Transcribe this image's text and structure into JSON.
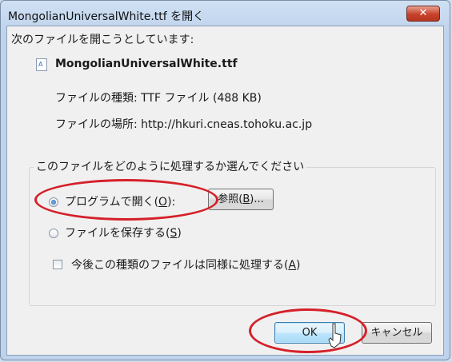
{
  "window": {
    "title": "MongolianUniversalWhite.ttf を開く",
    "close_label": "✕"
  },
  "prompt": "次のファイルを開こうとしています:",
  "file": {
    "name": "MongolianUniversalWhite.ttf",
    "type_line": "ファイルの種類: TTF ファイル (488 KB)",
    "location_line": "ファイルの場所: http://hkuri.cneas.tohoku.ac.jp"
  },
  "group": {
    "legend": "このファイルをどのように処理するか選んでください",
    "open_with": {
      "label": "プログラムで開く(",
      "key": "O",
      "suffix": "):",
      "selected": true
    },
    "browse": {
      "label": "参照(",
      "key": "B",
      "suffix": ")..."
    },
    "save": {
      "label": "ファイルを保存する(",
      "key": "S",
      "suffix": ")",
      "selected": false
    },
    "remember": {
      "label": "今後この種類のファイルは同様に処理する(",
      "key": "A",
      "suffix": ")",
      "checked": false
    }
  },
  "buttons": {
    "ok": "OK",
    "cancel": "キャンセル"
  },
  "colors": {
    "highlight_oval": "#d5202a",
    "ok_accent": "#3c7fb1"
  }
}
